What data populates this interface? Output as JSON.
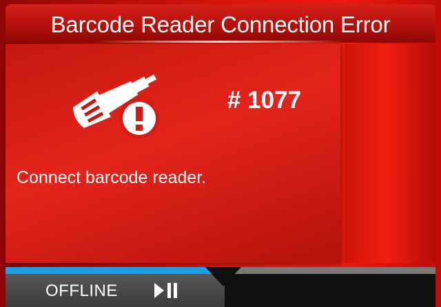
{
  "header": {
    "title": "Barcode Reader Connection Error"
  },
  "error": {
    "code": "# 1077",
    "message": "Connect barcode reader.",
    "icon": "barcode-reader-warning-icon"
  },
  "status": {
    "mode_label": "OFFLINE",
    "action_icon": "play-pause-icon",
    "progress": 0.49
  },
  "colors": {
    "error_red": "#d8140b",
    "progress_blue": "#1a9fe8",
    "status_dark": "#0f0f0f"
  }
}
